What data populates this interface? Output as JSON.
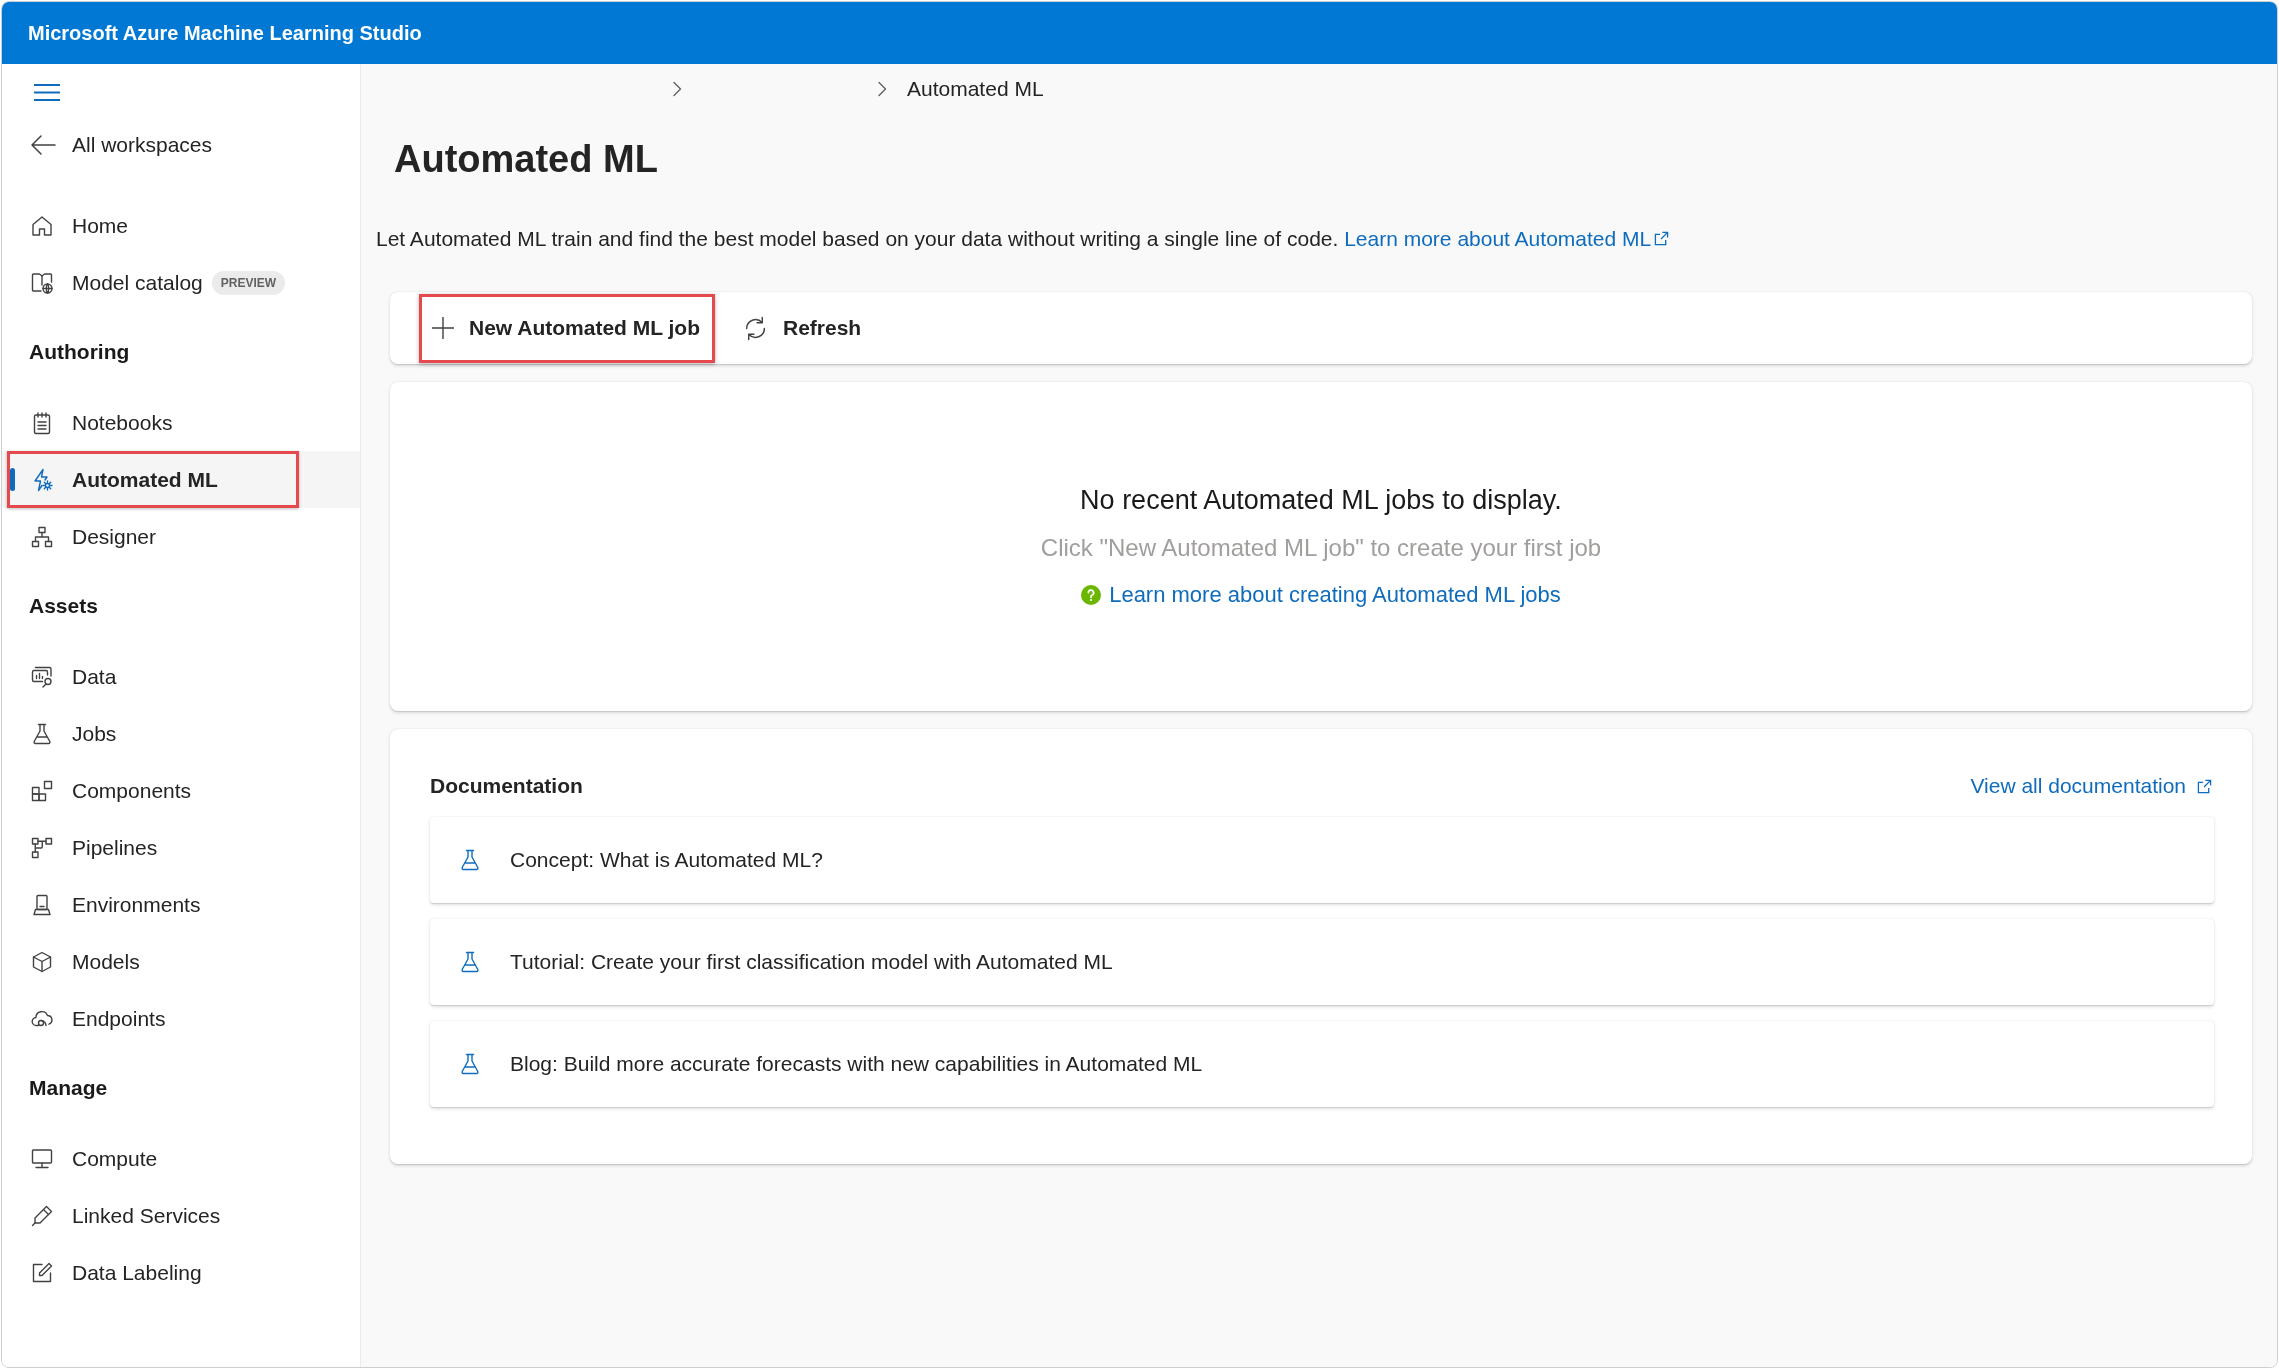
{
  "app_bar": {
    "title": "Microsoft Azure Machine Learning Studio"
  },
  "sidebar": {
    "back_link": "All workspaces",
    "groups": [
      {
        "items": [
          {
            "label": "Home",
            "selected": false,
            "highlighted": false
          },
          {
            "label": "Model catalog",
            "badge": "PREVIEW",
            "selected": false,
            "highlighted": false
          }
        ]
      },
      {
        "heading": "Authoring",
        "items": [
          {
            "label": "Notebooks",
            "selected": false,
            "highlighted": false
          },
          {
            "label": "Automated ML",
            "selected": true,
            "highlighted": true
          },
          {
            "label": "Designer",
            "selected": false,
            "highlighted": false
          }
        ]
      },
      {
        "heading": "Assets",
        "items": [
          {
            "label": "Data",
            "selected": false,
            "highlighted": false
          },
          {
            "label": "Jobs",
            "selected": false,
            "highlighted": false
          },
          {
            "label": "Components",
            "selected": false,
            "highlighted": false
          },
          {
            "label": "Pipelines",
            "selected": false,
            "highlighted": false
          },
          {
            "label": "Environments",
            "selected": false,
            "highlighted": false
          },
          {
            "label": "Models",
            "selected": false,
            "highlighted": false
          },
          {
            "label": "Endpoints",
            "selected": false,
            "highlighted": false
          }
        ]
      },
      {
        "heading": "Manage",
        "items": [
          {
            "label": "Compute",
            "selected": false,
            "highlighted": false
          },
          {
            "label": "Linked Services",
            "selected": false,
            "highlighted": false
          },
          {
            "label": "Data Labeling",
            "selected": false,
            "highlighted": false
          }
        ]
      }
    ]
  },
  "breadcrumb": [
    {
      "kind": "hidden"
    },
    {
      "kind": "hidden"
    },
    {
      "kind": "text",
      "label": "Automated ML"
    }
  ],
  "page": {
    "title": "Automated ML",
    "description": "Let Automated ML train and find the best model based on your data without writing a single line of code.",
    "description_link": "Learn more about Automated ML"
  },
  "toolbar": {
    "buttons": [
      {
        "kind": "new",
        "label": "New Automated ML job",
        "highlighted": true
      },
      {
        "kind": "refresh",
        "label": "Refresh",
        "highlighted": false
      }
    ]
  },
  "empty_state": {
    "title": "No recent Automated ML jobs to display.",
    "hint": "Click \"New Automated ML job\" to create your first job",
    "link": "Learn more about creating Automated ML jobs"
  },
  "documentation": {
    "heading": "Documentation",
    "view_all_link": "View all documentation",
    "items": [
      {
        "label": "Concept: What is Automated ML?"
      },
      {
        "label": "Tutorial: Create your first classification model with Automated ML"
      },
      {
        "label": "Blog: Build more accurate forecasts with new capabilities in Automated ML"
      }
    ]
  }
}
